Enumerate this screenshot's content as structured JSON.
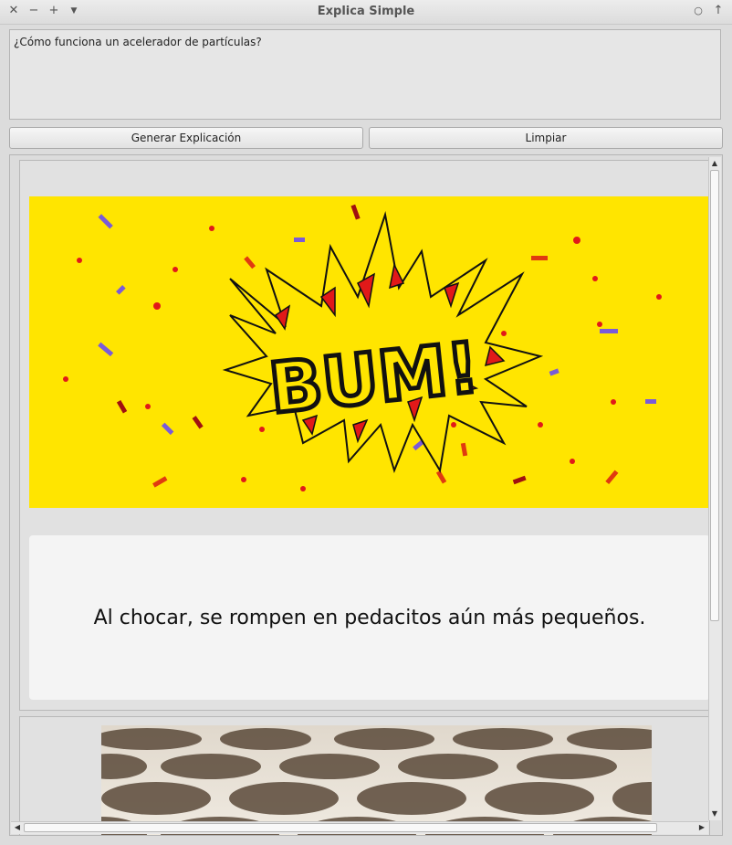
{
  "window": {
    "title": "Explica Simple",
    "controls_left": [
      "close-icon",
      "minimize-icon",
      "maximize-icon",
      "menu-icon"
    ],
    "controls_right": [
      "circle-icon",
      "up-icon"
    ]
  },
  "question": {
    "value": "¿Cómo funciona un acelerador de partículas?"
  },
  "buttons": {
    "generate_label": "Generar Explicación",
    "clear_label": "Limpiar"
  },
  "cards": [
    {
      "image_text": "BUM!",
      "caption": "Al chocar, se rompen en pedacitos aún más pequeños."
    },
    {
      "image": "seeds-photo"
    }
  ],
  "colors": {
    "illustration_background": "#ffe500",
    "burst_red": "#e11919"
  }
}
